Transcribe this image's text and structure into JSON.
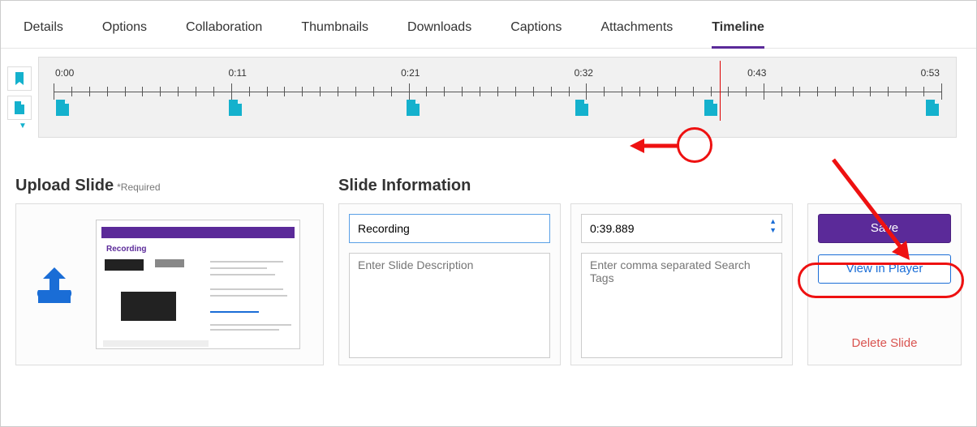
{
  "tabs": {
    "items": [
      "Details",
      "Options",
      "Collaboration",
      "Thumbnails",
      "Downloads",
      "Captions",
      "Attachments",
      "Timeline"
    ],
    "active_index": 7
  },
  "timeline": {
    "labels": [
      "0:00",
      "0:11",
      "0:21",
      "0:32",
      "0:43",
      "0:53"
    ],
    "markers_pct": [
      1.0,
      20.5,
      40.5,
      59.5,
      74.0,
      99.0
    ],
    "playhead_pct": 75.0
  },
  "upload": {
    "title": "Upload Slide",
    "required_label": "*Required",
    "thumb_title": "Recording"
  },
  "info": {
    "title": "Slide Information",
    "name_value": "Recording",
    "name_placeholder": "",
    "time_value": "0:39.889",
    "desc_placeholder": "Enter Slide Description",
    "tags_placeholder": "Enter comma separated Search Tags"
  },
  "actions": {
    "save": "Save",
    "view": "View in Player",
    "delete": "Delete Slide"
  }
}
